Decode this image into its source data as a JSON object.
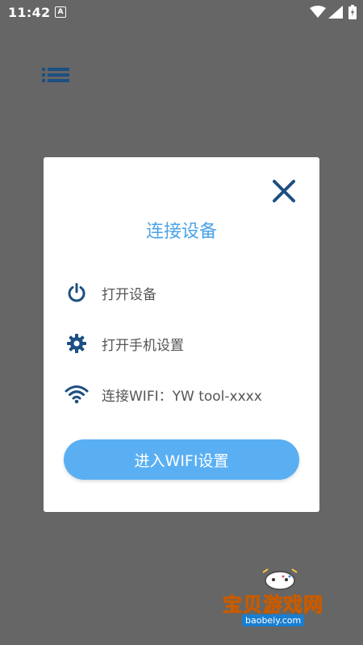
{
  "status_bar": {
    "time": "11:42",
    "notification_icon": "A"
  },
  "dialog": {
    "title": "连接设备",
    "items": [
      {
        "icon": "power-icon",
        "label": "打开设备"
      },
      {
        "icon": "gear-icon",
        "label": "打开手机设置"
      },
      {
        "icon": "wifi-icon",
        "label": "连接WIFI：YW tool-xxxx"
      }
    ],
    "button_label": "进入WIFI设置"
  },
  "watermark": {
    "brand": "宝贝游戏网",
    "domain": "baobeiy.com"
  },
  "colors": {
    "overlay": "#666666",
    "accent": "#4aa3e8",
    "icon": "#1d4f82",
    "button": "#5aaff3"
  }
}
